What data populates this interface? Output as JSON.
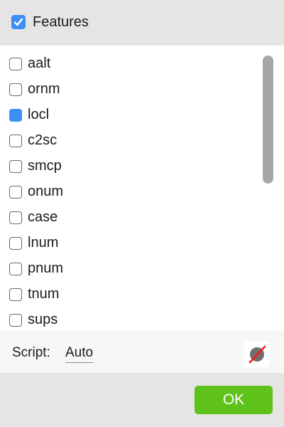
{
  "header": {
    "title": "Features",
    "checked": true,
    "accent_color": "#3d8ef5"
  },
  "features": [
    {
      "label": "aalt",
      "checked": false
    },
    {
      "label": "ornm",
      "checked": false
    },
    {
      "label": "locl",
      "checked": true
    },
    {
      "label": "c2sc",
      "checked": false
    },
    {
      "label": "smcp",
      "checked": false
    },
    {
      "label": "onum",
      "checked": false
    },
    {
      "label": "case",
      "checked": false
    },
    {
      "label": "lnum",
      "checked": false
    },
    {
      "label": "pnum",
      "checked": false
    },
    {
      "label": "tnum",
      "checked": false
    },
    {
      "label": "sups",
      "checked": false
    }
  ],
  "script": {
    "label": "Script:",
    "value": "Auto",
    "clear_icon": "no-entry-icon"
  },
  "footer": {
    "ok_label": "OK",
    "ok_color": "#5ec21b"
  }
}
